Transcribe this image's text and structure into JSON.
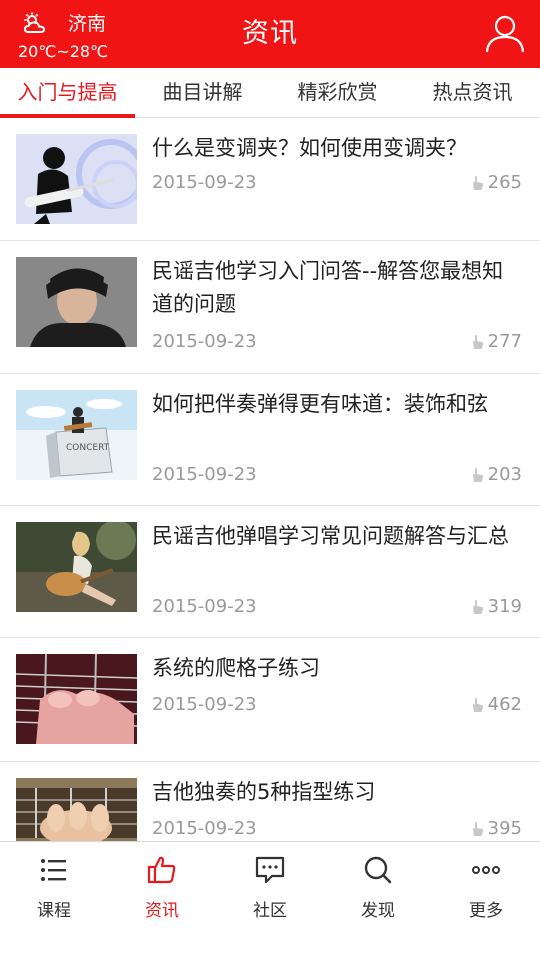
{
  "header": {
    "weather_icon": "partly-cloudy-icon",
    "city": "济南",
    "temperature": "20℃~28℃",
    "title": "资讯",
    "user_icon": "user-icon",
    "color": "#f01414"
  },
  "tabs": [
    {
      "label": "入门与提高",
      "active": true
    },
    {
      "label": "曲目讲解",
      "active": false
    },
    {
      "label": "精彩欣赏",
      "active": false
    },
    {
      "label": "热点资讯",
      "active": false
    }
  ],
  "articles": [
    {
      "title": "什么是变调夹？如何使用变调夹？",
      "date": "2015-09-23",
      "likes": "265"
    },
    {
      "title": "民谣吉他学习入门问答--解答您最想知道的问题",
      "date": "2015-09-23",
      "likes": "277"
    },
    {
      "title": "如何把伴奏弹得更有味道：装饰和弦",
      "date": "2015-09-23",
      "likes": "203"
    },
    {
      "title": "民谣吉他弹唱学习常见问题解答与汇总",
      "date": "2015-09-23",
      "likes": "319"
    },
    {
      "title": "系统的爬格子练习",
      "date": "2015-09-23",
      "likes": "462"
    },
    {
      "title": "吉他独奏的5种指型练习",
      "date": "2015-09-23",
      "likes": "395"
    }
  ],
  "bottom_nav": [
    {
      "label": "课程",
      "icon": "list-icon",
      "active": false
    },
    {
      "label": "资讯",
      "icon": "thumbs-up-icon",
      "active": true
    },
    {
      "label": "社区",
      "icon": "chat-icon",
      "active": false
    },
    {
      "label": "发现",
      "icon": "search-icon",
      "active": false
    },
    {
      "label": "更多",
      "icon": "more-icon",
      "active": false
    }
  ],
  "accent_color": "#e8191c"
}
